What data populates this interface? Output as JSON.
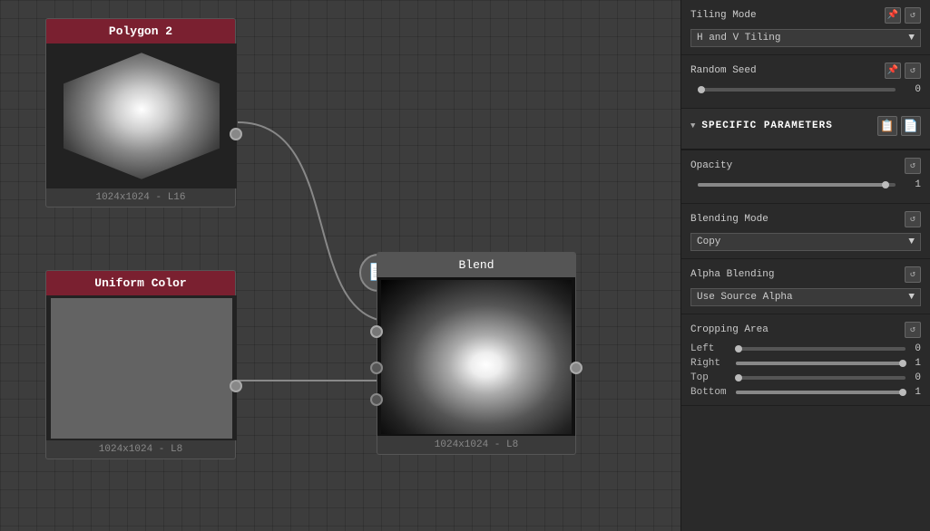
{
  "canvas": {
    "background_color": "#3d3d3d"
  },
  "nodes": {
    "polygon": {
      "title": "Polygon 2",
      "size": "1024x1024 - L16",
      "header_color": "#7a2030"
    },
    "uniform": {
      "title": "Uniform Color",
      "size": "1024x1024 - L8",
      "header_color": "#7a2030"
    },
    "blend": {
      "title": "Blend",
      "size": "1024x1024 - L8"
    }
  },
  "icon_buttons": {
    "copy_label": "📋",
    "blend_label": "⬛"
  },
  "right_panel": {
    "tiling_mode": {
      "label": "Tiling Mode",
      "value": "H and V Tiling"
    },
    "random_seed": {
      "label": "Random Seed",
      "value": "0",
      "slider_percent": 2
    },
    "specific_parameters": {
      "label": "SPECIFIC PARAMETERS",
      "opacity": {
        "label": "Opacity",
        "value": "1",
        "slider_percent": 95
      },
      "blending_mode": {
        "label": "Blending Mode",
        "value": "Copy"
      },
      "alpha_blending": {
        "label": "Alpha Blending",
        "value": "Use Source Alpha"
      },
      "cropping_area": {
        "label": "Cropping Area",
        "left": {
          "label": "Left",
          "value": "0",
          "slider_percent": 2
        },
        "right": {
          "label": "Right",
          "value": "1",
          "slider_percent": 98
        },
        "top": {
          "label": "Top",
          "value": "0",
          "slider_percent": 2
        },
        "bottom": {
          "label": "Bottom",
          "value": "1",
          "slider_percent": 98
        }
      }
    }
  }
}
